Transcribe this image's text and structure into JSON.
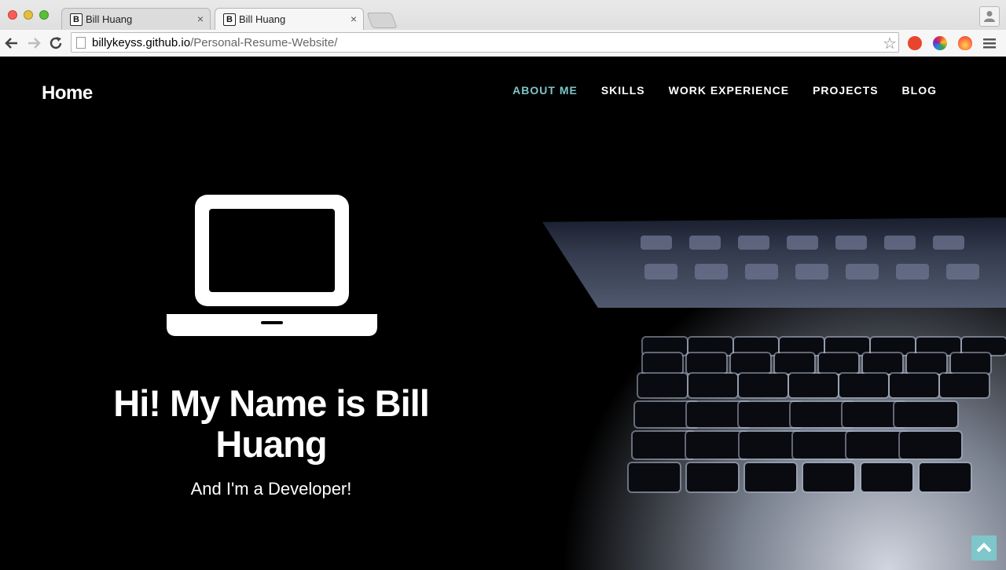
{
  "browser": {
    "tabs": [
      {
        "label": "Bill Huang",
        "favicon": "B",
        "active": false
      },
      {
        "label": "Bill Huang",
        "favicon": "B",
        "active": true
      }
    ],
    "url_host": "billykeyss.github.io",
    "url_path": "/Personal-Resume-Website/",
    "close_glyph": "×",
    "star_glyph": "☆"
  },
  "site": {
    "home_label": "Home",
    "nav": [
      {
        "label": "ABOUT ME",
        "active": true
      },
      {
        "label": "SKILLS",
        "active": false
      },
      {
        "label": "WORK EXPERIENCE",
        "active": false
      },
      {
        "label": "PROJECTS",
        "active": false
      },
      {
        "label": "BLOG",
        "active": false
      }
    ],
    "hero": {
      "title": "Hi! My Name is Bill Huang",
      "subtitle": "And I'm a Developer!",
      "icon": "laptop-icon"
    },
    "scroll_top_icon": "chevron-up-icon"
  },
  "colors": {
    "accent": "#7ec6c9",
    "page_bg": "#000000",
    "text": "#ffffff"
  }
}
